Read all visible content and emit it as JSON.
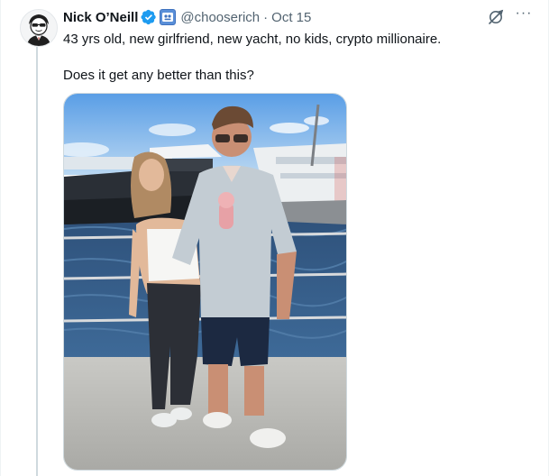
{
  "tweet": {
    "author": {
      "display_name": "Nick O’Neill",
      "handle": "@chooserich",
      "avatar_icon": "cartoon-avatar-icon",
      "verified_color": "#1d9bf0"
    },
    "separator": "·",
    "timestamp": "Oct 15",
    "text_lines": [
      "43 yrs old, new girlfriend, new yacht, no kids, crypto millionaire.",
      "Does it get any better than this?"
    ],
    "media": {
      "kind": "photo",
      "icon": "photo-image-icon"
    }
  },
  "header_actions": {
    "grok_icon": "grok-icon",
    "more_icon": "more-options-icon",
    "more_label": "···"
  },
  "colors": {
    "secondary_text": "#536471",
    "primary_text": "#0f1419",
    "thread_line": "#cfd9de"
  }
}
